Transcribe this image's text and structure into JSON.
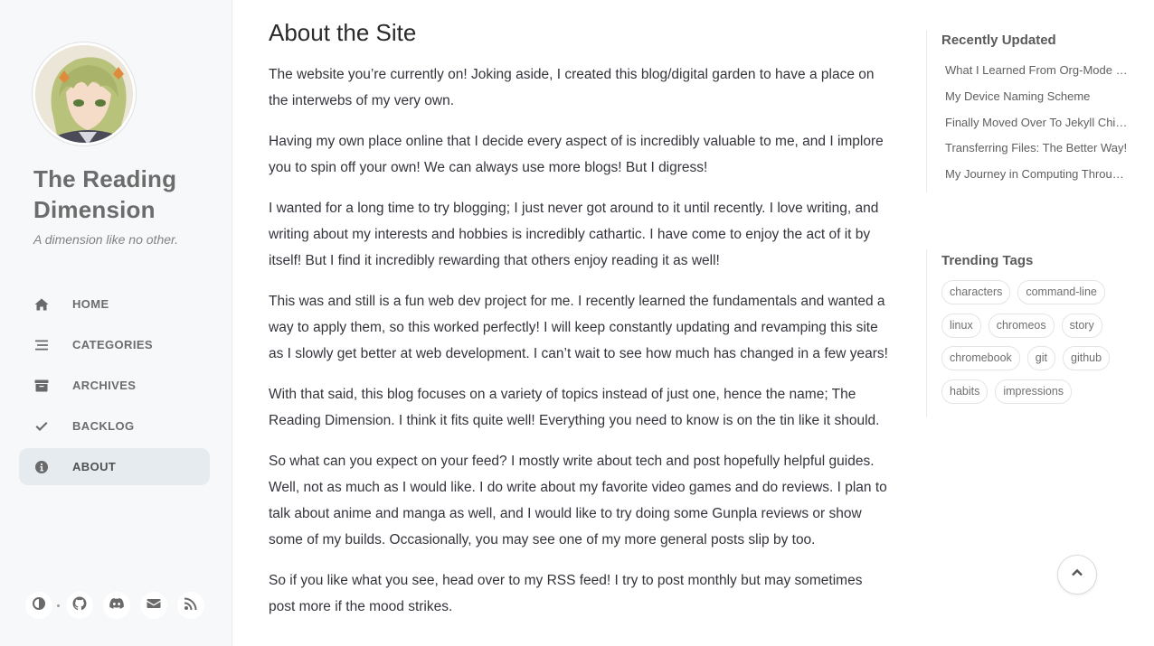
{
  "sidebar": {
    "site_title": "The Reading Dimension",
    "subtitle": "A dimension like no other.",
    "nav": [
      {
        "label": "HOME",
        "icon": "home-icon"
      },
      {
        "label": "CATEGORIES",
        "icon": "stream-icon"
      },
      {
        "label": "ARCHIVES",
        "icon": "archive-icon"
      },
      {
        "label": "BACKLOG",
        "icon": "check-icon"
      },
      {
        "label": "ABOUT",
        "icon": "info-circle-icon",
        "active": true
      }
    ],
    "bottom_icons": [
      "theme-toggle-icon",
      "github-icon",
      "discord-icon",
      "email-icon",
      "rss-icon"
    ]
  },
  "main": {
    "title": "About the Site",
    "paragraphs": [
      "The website you’re currently on! Joking aside, I created this blog/digital garden to have a place on the interwebs of my very own.",
      "Having my own place online that I decide every aspect of is incredibly valuable to me, and I implore you to spin off your own! We can always use more blogs! But I digress!",
      "I wanted for a long time to try blogging; I just never got around to it until recently. I love writing, and writing about my interests and hobbies is incredibly cathartic. I have come to enjoy the act of it by itself! But I find it incredibly rewarding that others enjoy reading it as well!",
      "This was and still is a fun web dev project for me. I recently learned the fundamentals and wanted a way to apply them, so this worked perfectly! I will keep constantly updating and revamping this site as I slowly get better at web development. I can’t wait to see how much has changed in a few years!",
      "With that said, this blog focuses on a variety of topics instead of just one, hence the name; The Reading Dimension. I think it fits quite well! Everything you need to know is on the tin like it should.",
      "So what can you expect on your feed? I mostly write about tech and post hopefully helpful guides. Well, not as much as I would like. I do write about my favorite video games and do reviews. I plan to talk about anime and manga as well, and I would like to try doing some Gunpla reviews or show some of my builds. Occasionally, you may see one of my more general posts slip by too.",
      "So if you like what you see, head over to my RSS feed! I try to post monthly but may sometimes post more if the mood strikes."
    ]
  },
  "recently_updated": {
    "heading": "Recently Updated",
    "items": [
      "What I Learned From Org-Mode …",
      "My Device Naming Scheme",
      "Finally Moved Over To Jekyll Chi…",
      "Transferring Files: The Better Way!",
      "My Journey in Computing Throu…"
    ]
  },
  "trending_tags": {
    "heading": "Trending Tags",
    "tags": [
      "characters",
      "command-line",
      "linux",
      "chromeos",
      "story",
      "chromebook",
      "git",
      "github",
      "habits",
      "impressions"
    ]
  },
  "colors": {
    "sidebar_bg": "#f6f8fa",
    "active_nav_bg": "#e6ebf0",
    "text": "#34343c"
  }
}
